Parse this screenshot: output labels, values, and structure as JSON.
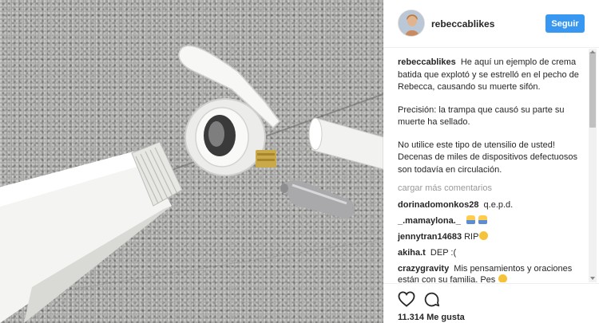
{
  "post": {
    "username": "rebeccablikes",
    "follow_label": "Seguir",
    "caption_user": "rebeccablikes",
    "caption_paragraphs": [
      "He aquí un ejemplo de crema batida que explotó y se estrelló en el pecho de Rebecca, causando su muerte sifón.",
      "Precisión: la trampa que causó su parte su muerte ha sellado.",
      "No utilice este tipo de utensilio de usted! Decenas de miles de dispositivos defectuosos son todavía en circulación."
    ],
    "load_more": "cargar más comentarios",
    "comments": [
      {
        "user": "dorinadomonkos28",
        "text": "q.e.p.d.",
        "emoji": ""
      },
      {
        "user": "_.mamaylona._",
        "text": "",
        "emoji": "person-person"
      },
      {
        "user": "jennytran14683",
        "text": "RIP",
        "emoji": "sad-face"
      },
      {
        "user": "akiha.t",
        "text": "DEP :(",
        "emoji": ""
      },
      {
        "user": "crazygravity",
        "text": "Mis pensamientos y oraciones están con su familia. Pes",
        "emoji": "sad-face"
      }
    ],
    "likes": "11.314 Me gusta"
  },
  "colors": {
    "follow_button": "#3897f0",
    "text": "#262626",
    "muted": "#999999"
  },
  "icons": [
    "heart-icon",
    "comment-icon",
    "avatar"
  ]
}
